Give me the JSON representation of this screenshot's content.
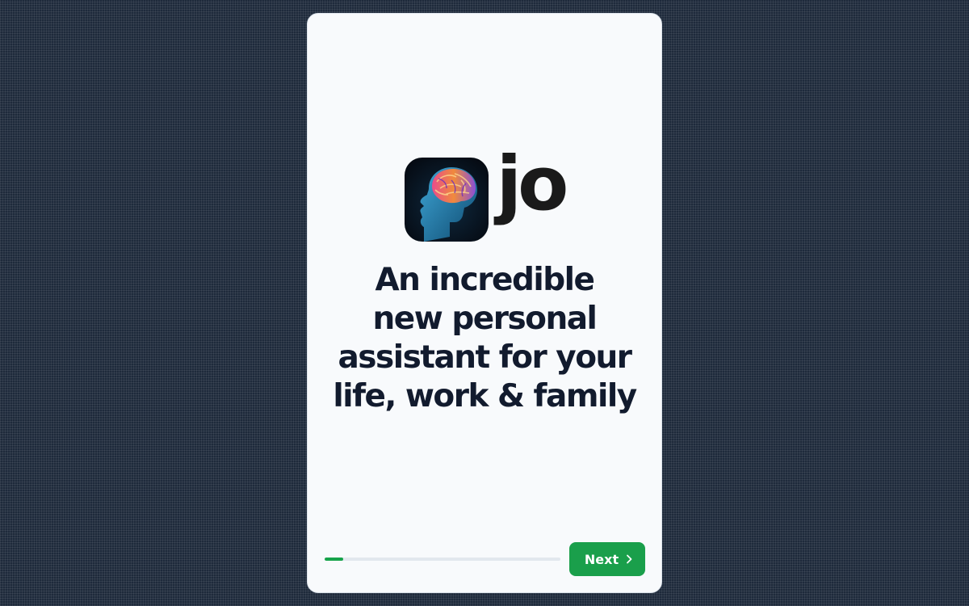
{
  "app": {
    "name": "jo",
    "icon": "brain-head-icon"
  },
  "onboarding": {
    "headline_lines": [
      "An incredible",
      "new personal",
      "assistant for your",
      "life, work & family"
    ],
    "progress": 0.08,
    "next_label": "Next",
    "next_icon": "chevron-right-icon"
  },
  "colors": {
    "background": "#1e2a3b",
    "card": "#f8fafc",
    "accent": "#16a34a",
    "headline": "#121b2e"
  }
}
